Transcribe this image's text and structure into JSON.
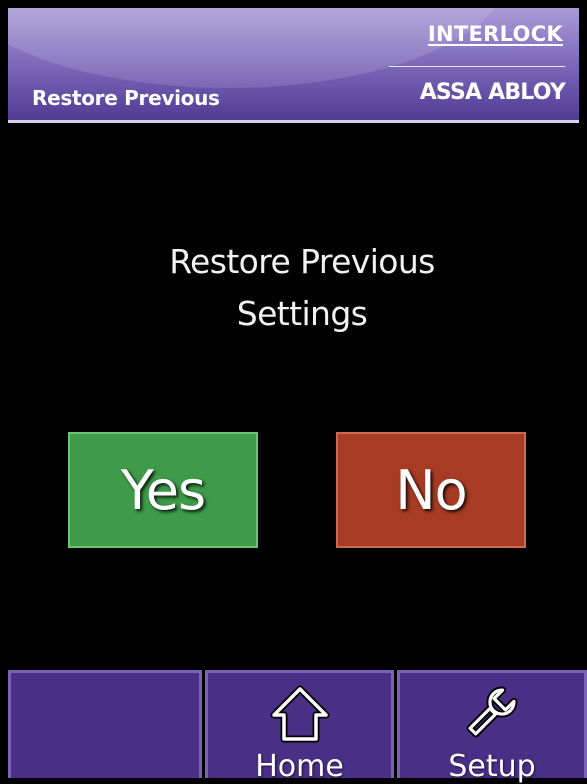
{
  "header": {
    "title": "Restore Previous",
    "logo_top": "INTERLOCK",
    "logo_bottom": "ASSA ABLOY"
  },
  "prompt": {
    "line1": "Restore Previous",
    "line2": "Settings"
  },
  "buttons": {
    "yes_label": "Yes",
    "no_label": "No"
  },
  "nav": {
    "home_label": "Home",
    "setup_label": "Setup",
    "home_icon": "home-icon",
    "setup_icon": "wrench-icon"
  },
  "colors": {
    "header": "#6a56ab",
    "yes": "#3e9b4a",
    "no": "#a73b24",
    "nav": "#4a2f86",
    "background": "#000000"
  }
}
